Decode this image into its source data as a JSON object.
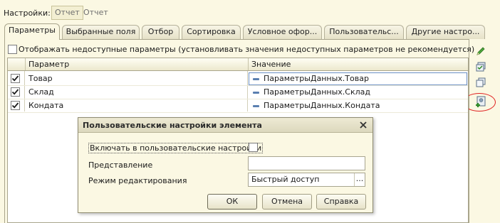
{
  "settings": {
    "label": "Настройки:",
    "modes": [
      "Отчет",
      "Отчет"
    ]
  },
  "tabs": [
    "Параметры",
    "Выбранные поля",
    "Отбор",
    "Сортировка",
    "Условное офор...",
    "Пользовательс...",
    "Другие настро..."
  ],
  "show_unavailable_label": "Отображать недоступные параметры (установливать значения недоступных параметров не рекомендуется)",
  "grid": {
    "headers": {
      "param": "Параметр",
      "value": "Значение"
    },
    "rows": [
      {
        "param": "Товар",
        "value": "ПараметрыДанных.Товар"
      },
      {
        "param": "Склад",
        "value": "ПараметрыДанных.Склад"
      },
      {
        "param": "Кондата",
        "value": "ПараметрыДанных.Кондата"
      }
    ]
  },
  "dialog": {
    "title": "Пользовательские настройки элемента",
    "include_label": "Включать в пользовательские настройки",
    "presentation_label": "Представление",
    "presentation_value": "",
    "mode_label": "Режим редактирования",
    "mode_value": "Быстрый доступ",
    "dots": "...",
    "ok": "ОК",
    "cancel": "Отмена",
    "help": "Справка"
  },
  "colors": {
    "background": "#fbf8e3",
    "toolbar_green": "#3a9a2a",
    "annotation": "#e02020"
  }
}
